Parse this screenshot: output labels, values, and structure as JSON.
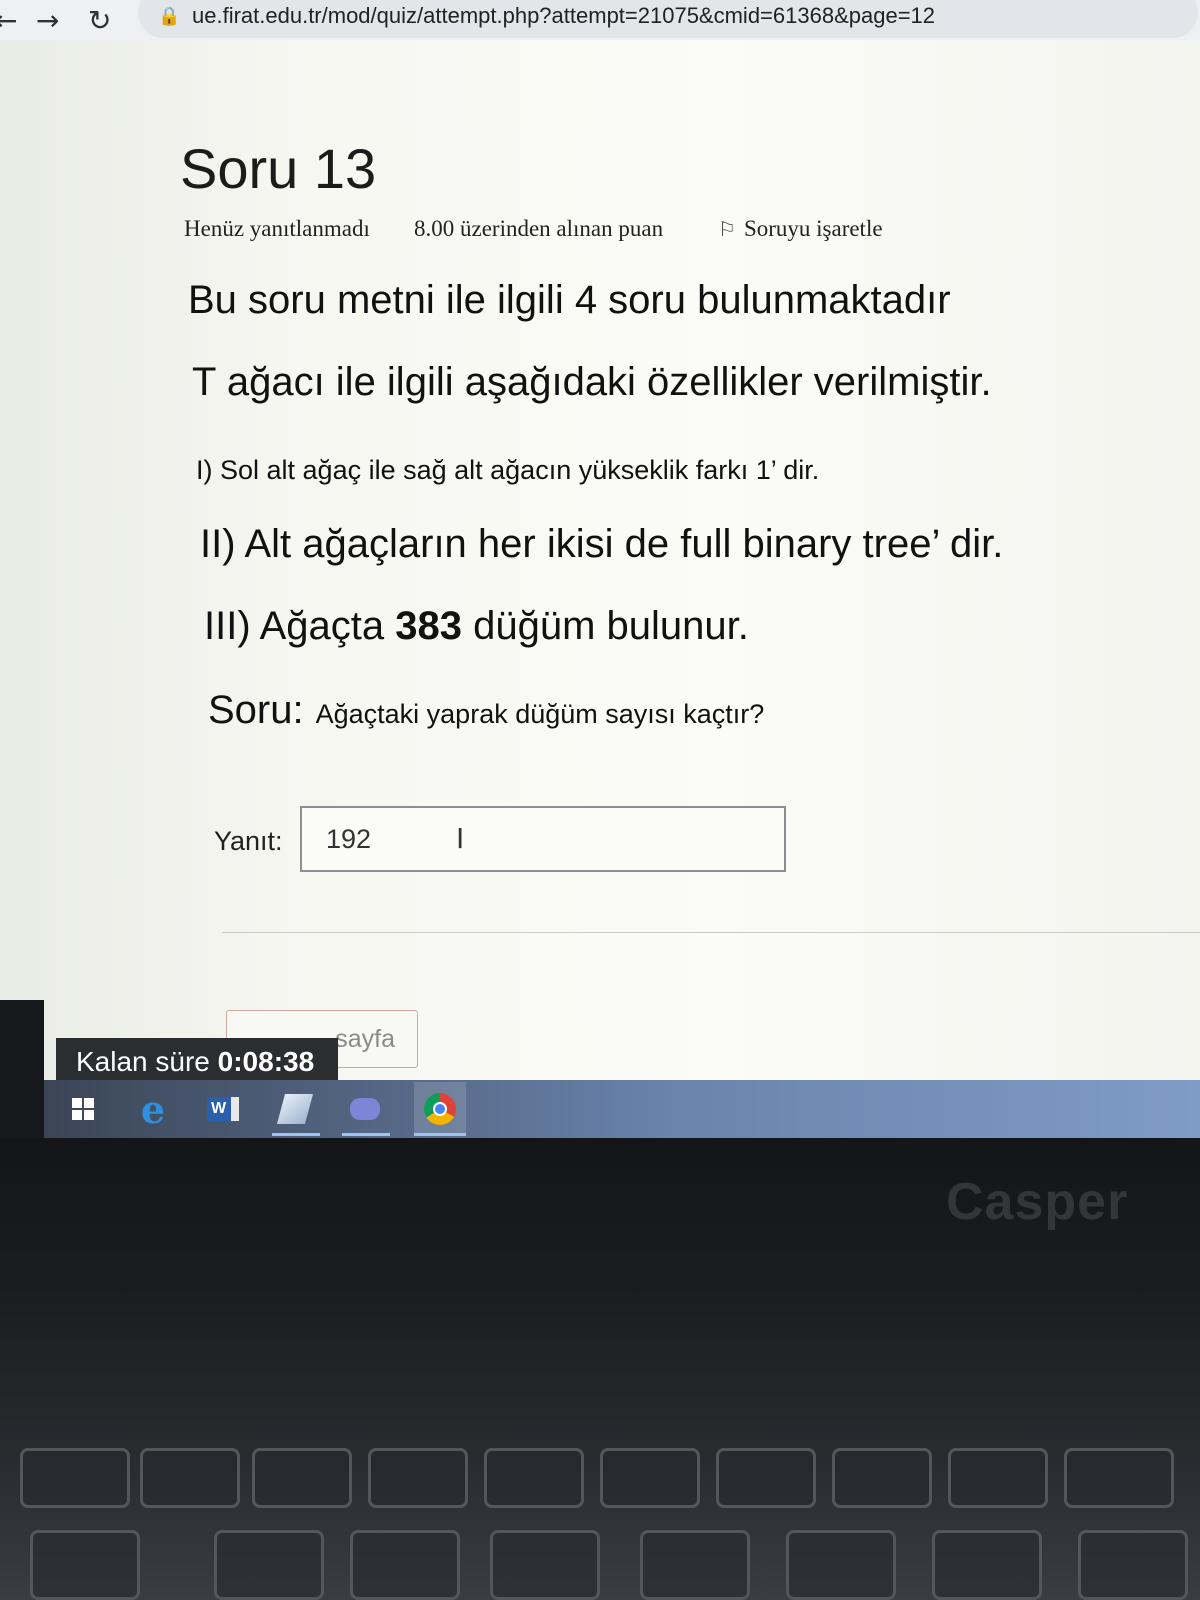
{
  "browser": {
    "url_main": "ue.firat.edu.tr/mod/quiz/attempt.php?attempt=21075&cmid=61368&page=12",
    "back_icon": "arrow-left-icon",
    "forward_icon": "arrow-right-icon",
    "reload_icon": "reload-icon",
    "lock_icon": "lock-icon"
  },
  "question": {
    "title": "Soru 13",
    "status": "Henüz yanıtlanmadı",
    "points": "8.00 üzerinden alınan puan",
    "flag_label": "Soruyu işaretle",
    "intro": "Bu soru metni ile ilgili 4 soru bulunmaktadır",
    "statement": "T ağacı ile ilgili aşağıdaki özellikler verilmiştir.",
    "cond1": "I) Sol alt ağaç ile sağ alt ağacın yükseklik farkı 1’ dir.",
    "cond2": "II) Alt ağaçların her ikisi de full binary tree’ dir.",
    "cond3_pre": "III) Ağaçta ",
    "cond3_num": "383",
    "cond3_post": " düğüm bulunur.",
    "soru_label": "Soru:",
    "soru_text": "Ağaçtaki yaprak düğüm sayısı kaçtır?"
  },
  "answer": {
    "label": "Yanıt:",
    "value": "192"
  },
  "navigation": {
    "prev_label": "sayfa"
  },
  "timer": {
    "label": "Kalan süre",
    "value": "0:08:38"
  },
  "taskbar": {
    "icons": [
      "windows-icon",
      "edge-icon",
      "word-icon",
      "pencil-icon",
      "discord-icon",
      "chrome-icon"
    ],
    "word_letter": "W"
  },
  "laptop": {
    "brand": "Casper"
  }
}
